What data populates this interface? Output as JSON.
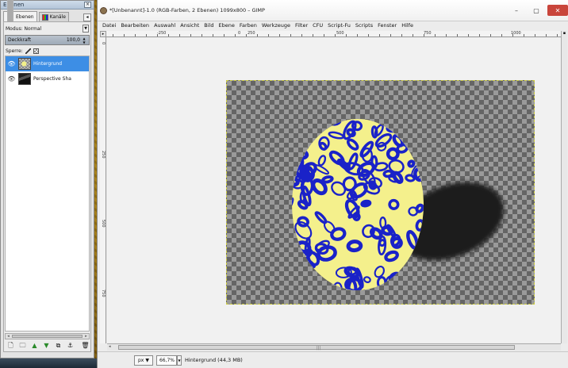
{
  "dock": {
    "title": "Ebenen",
    "tabs": [
      {
        "label": "Ebenen",
        "icon": "layers-tab-icon"
      },
      {
        "label": "Kanäle",
        "icon": "channels-tab-icon"
      }
    ],
    "mode_label": "Modus: Normal",
    "opacity_label": "Deckkraft",
    "opacity_value": "100,0",
    "lock_label": "Sperre:",
    "layers": [
      {
        "name": "Hintergrund",
        "selected": true
      },
      {
        "name": "Perspective Sha",
        "selected": false
      }
    ]
  },
  "window": {
    "title": "*[Unbenannt]-1.0 (RGB-Farben, 2 Ebenen) 1099x800 – GIMP",
    "menu": [
      "Datei",
      "Bearbeiten",
      "Auswahl",
      "Ansicht",
      "Bild",
      "Ebene",
      "Farben",
      "Werkzeuge",
      "Filter",
      "CFU",
      "Script-Fu",
      "Scripts",
      "Fenster",
      "Hilfe"
    ],
    "ruler_top_labels": [
      "-250",
      "0",
      "250",
      "500",
      "750",
      "1000"
    ],
    "ruler_left_labels": [
      "0",
      "250",
      "500",
      "750"
    ]
  },
  "status": {
    "unit": "px",
    "zoom": "66,7%",
    "message": "Hintergrund (44,3 MB)"
  },
  "colors": {
    "ellipse_fill": "#f4f08c",
    "pattern_blue": "#1a22c8",
    "shadow": "#1a1a1a",
    "selected_layer": "#3d8ee5"
  }
}
